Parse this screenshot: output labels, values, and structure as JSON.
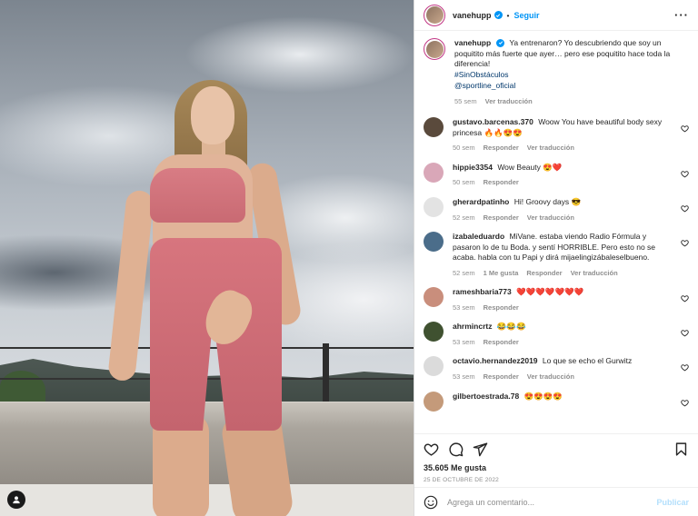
{
  "header": {
    "username": "vanehupp",
    "separator": "•",
    "follow_label": "Seguir",
    "more_label": "···"
  },
  "caption": {
    "username": "vanehupp",
    "text": "Ya entrenaron? Yo descubriendo que soy un poquitito más fuerte que ayer… pero ese poquitito hace toda la diferencia!",
    "hashtag": "#SinObstáculos",
    "mention": "@sportline_oficial",
    "time": "55 sem",
    "translate": "Ver traducción"
  },
  "comments": [
    {
      "username": "gustavo.barcenas.370",
      "text": "Woow You have beautiful body sexy princesa 🔥🔥😍😍",
      "time": "50 sem",
      "likes": "",
      "reply": "Responder",
      "translate": "Ver traducción",
      "avatar_color": "#5a4a3c"
    },
    {
      "username": "hippie3354",
      "text": "Wow Beauty 😍❤️",
      "time": "50 sem",
      "likes": "",
      "reply": "Responder",
      "translate": "",
      "avatar_color": "#d9a7b8"
    },
    {
      "username": "gherardpatinho",
      "text": "Hi! Groovy days 😎",
      "time": "52 sem",
      "likes": "",
      "reply": "Responder",
      "translate": "Ver traducción",
      "avatar_color": "#e3e3e3"
    },
    {
      "username": "izabaleduardo",
      "text": "MiVane. estaba viendo Radio Fórmula y pasaron lo de tu Boda. y sentí HORRIBLE. Pero esto no se acaba. habla con tu Papi y dirá mijaelingizábaleselbueno.",
      "time": "52 sem",
      "likes": "1 Me gusta",
      "reply": "Responder",
      "translate": "Ver traducción",
      "avatar_color": "#4b6d8a"
    },
    {
      "username": "rameshbaria773",
      "text": "❤️❤️❤️❤️❤️❤️❤️",
      "time": "53 sem",
      "likes": "",
      "reply": "Responder",
      "translate": "",
      "avatar_color": "#c98e7c"
    },
    {
      "username": "ahrmincrtz",
      "text": "😂😂😂",
      "time": "53 sem",
      "likes": "",
      "reply": "Responder",
      "translate": "",
      "avatar_color": "#3f5130"
    },
    {
      "username": "octavio.hernandez2019",
      "text": "Lo que se echo el Gurwitz",
      "time": "53 sem",
      "likes": "",
      "reply": "Responder",
      "translate": "Ver traducción",
      "avatar_color": "#dbdbdb"
    },
    {
      "username": "gilbertoestrada.78",
      "text": "😍😍😍😍",
      "time": "",
      "likes": "",
      "reply": "",
      "translate": "",
      "avatar_color": "#c49a7a"
    }
  ],
  "actions": {
    "likes": "35.605 Me gusta",
    "date": "25 DE OCTUBRE DE 2022"
  },
  "add_comment": {
    "placeholder": "Agrega un comentario...",
    "publish_label": "Publicar"
  },
  "colors": {
    "accent": "#0095f6",
    "shorts": "#c96a73"
  }
}
